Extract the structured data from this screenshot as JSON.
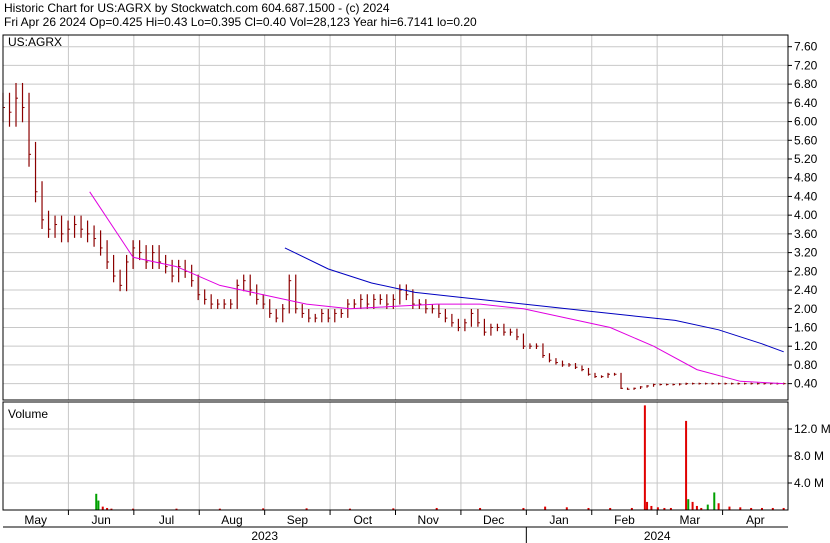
{
  "header": {
    "line1": "Historic Chart for US:AGRX by Stockwatch.com 604.687.1500 - (c) 2024",
    "line2": "Fri Apr 26 2024   Op=0.425   Hi=0.43   Lo=0.395   Cl=0.40   Vol=28,123   Year hi=6.7141   lo=0.20"
  },
  "price_panel": {
    "symbol_label": "US:AGRX"
  },
  "volume_panel": {
    "label": "Volume"
  },
  "colors": {
    "candle": "#8b0000",
    "ma_short": "#e000e0",
    "ma_long": "#0000c0",
    "volume_up": "#00a000",
    "volume_down": "#e00000",
    "grid": "#c8c8c8"
  },
  "chart_data": [
    {
      "type": "line",
      "title": "US:AGRX",
      "x_labels": [
        "May",
        "Jun",
        "Jul",
        "Aug",
        "Sep",
        "Oct",
        "Nov",
        "Dec",
        "Jan",
        "Feb",
        "Mar",
        "Apr"
      ],
      "year_labels": [
        "2023",
        "2024"
      ],
      "y_ticks": [
        "7.60",
        "7.20",
        "6.80",
        "6.40",
        "6.00",
        "5.60",
        "5.20",
        "4.80",
        "4.40",
        "4.00",
        "3.60",
        "3.20",
        "2.80",
        "2.40",
        "2.00",
        "1.60",
        "1.20",
        "0.80",
        "0.40"
      ],
      "ylim": [
        0.05,
        7.85
      ],
      "grid": true,
      "series": [
        {
          "kind": "price-bars",
          "x": [
            0,
            3,
            6,
            9,
            12,
            15,
            18,
            21,
            24,
            27,
            30,
            33,
            36,
            39,
            42,
            45,
            48,
            51,
            54,
            57,
            60,
            63,
            66,
            69,
            72,
            75,
            78,
            81,
            84,
            87,
            90,
            93,
            96,
            99,
            102,
            105,
            108,
            111,
            114,
            117,
            120,
            123,
            126,
            129,
            132,
            135,
            138,
            141,
            144,
            147,
            150,
            153,
            156,
            159,
            162,
            165,
            168,
            171,
            174,
            177,
            180,
            183,
            186,
            189,
            192,
            195,
            198,
            201,
            204,
            207,
            210,
            213,
            216,
            219,
            222,
            225,
            228,
            231,
            234,
            237,
            240,
            243,
            246,
            249,
            252,
            255,
            258,
            261,
            264,
            267,
            270,
            273,
            276,
            279,
            282,
            285,
            288,
            291,
            294,
            297,
            300,
            303,
            306,
            309,
            312,
            315,
            318,
            321,
            324,
            327,
            330,
            333,
            336,
            339,
            342,
            345,
            348,
            351,
            354,
            357,
            360
          ],
          "close": [
            6.3,
            6.2,
            6.5,
            6.3,
            5.3,
            4.5,
            3.9,
            3.7,
            3.8,
            3.6,
            3.7,
            3.8,
            3.7,
            3.6,
            3.5,
            3.3,
            3.0,
            2.7,
            2.5,
            3.0,
            3.3,
            3.2,
            3.0,
            3.2,
            3.0,
            2.9,
            2.7,
            2.9,
            2.8,
            2.6,
            2.3,
            2.2,
            2.1,
            2.1,
            2.1,
            2.1,
            2.5,
            2.6,
            2.4,
            2.2,
            2.1,
            1.9,
            1.8,
            2.0,
            2.6,
            2.0,
            1.9,
            1.8,
            1.8,
            1.9,
            1.8,
            1.9,
            1.9,
            2.1,
            2.1,
            2.2,
            2.1,
            2.2,
            2.2,
            2.1,
            2.2,
            2.4,
            2.3,
            2.1,
            2.1,
            2.0,
            2.0,
            1.9,
            1.8,
            1.7,
            1.6,
            1.7,
            1.9,
            1.7,
            1.5,
            1.6,
            1.6,
            1.5,
            1.5,
            1.4,
            1.2,
            1.2,
            1.2,
            1.0,
            0.9,
            0.85,
            0.8,
            0.8,
            0.75,
            0.7,
            0.6,
            0.55,
            0.55,
            0.6,
            0.6,
            0.3,
            0.28,
            0.3,
            0.33,
            0.35,
            0.38,
            0.38,
            0.38,
            0.38,
            0.39,
            0.4,
            0.4,
            0.4,
            0.4,
            0.4,
            0.4,
            0.4,
            0.4,
            0.4,
            0.4,
            0.4,
            0.4,
            0.4,
            0.4,
            0.4,
            0.4
          ]
        },
        {
          "name": "",
          "kind": "moving-average-short",
          "x": [
            40,
            60,
            80,
            100,
            120,
            140,
            160,
            180,
            200,
            220,
            240,
            260,
            280,
            300,
            320,
            340,
            360
          ],
          "y": [
            4.5,
            3.1,
            2.9,
            2.5,
            2.3,
            2.1,
            2.0,
            2.05,
            2.1,
            2.1,
            2.0,
            1.8,
            1.6,
            1.2,
            0.7,
            0.45,
            0.4
          ]
        },
        {
          "name": "",
          "kind": "moving-average-long",
          "x": [
            130,
            150,
            170,
            190,
            210,
            230,
            250,
            270,
            290,
            310,
            330,
            350,
            360
          ],
          "y": [
            3.3,
            2.85,
            2.55,
            2.35,
            2.25,
            2.15,
            2.05,
            1.95,
            1.85,
            1.75,
            1.55,
            1.25,
            1.08
          ]
        }
      ]
    },
    {
      "type": "bar",
      "title": "Volume",
      "y_ticks": [
        "12.0 M",
        "8.0 M",
        "4.0 M"
      ],
      "ylim": [
        0,
        16.0
      ],
      "unit": "M",
      "grid": true,
      "series": [
        {
          "kind": "volume",
          "x": [
            43,
            44,
            46,
            48,
            50,
            60,
            80,
            100,
            120,
            140,
            160,
            180,
            200,
            220,
            240,
            250,
            260,
            270,
            280,
            290,
            296,
            297,
            299,
            302,
            305,
            308,
            315,
            316,
            318,
            320,
            322,
            325,
            328,
            330,
            335,
            340,
            345,
            350,
            355,
            360
          ],
          "values": [
            2.4,
            1.4,
            0.5,
            0.3,
            0.2,
            0.2,
            0.2,
            0.2,
            0.25,
            0.25,
            0.2,
            0.25,
            0.3,
            0.3,
            0.3,
            0.5,
            0.4,
            0.3,
            0.3,
            0.3,
            15.5,
            1.2,
            0.6,
            0.4,
            0.3,
            0.3,
            13.2,
            1.6,
            1.2,
            0.6,
            0.3,
            0.8,
            2.6,
            1.0,
            0.5,
            0.4,
            0.3,
            0.3,
            0.3,
            0.3
          ],
          "up": [
            true,
            true,
            false,
            false,
            false,
            false,
            false,
            false,
            false,
            false,
            false,
            false,
            false,
            false,
            false,
            false,
            false,
            false,
            false,
            false,
            false,
            false,
            false,
            false,
            false,
            false,
            false,
            true,
            false,
            false,
            false,
            true,
            true,
            false,
            false,
            false,
            false,
            false,
            false,
            false
          ]
        }
      ]
    }
  ]
}
